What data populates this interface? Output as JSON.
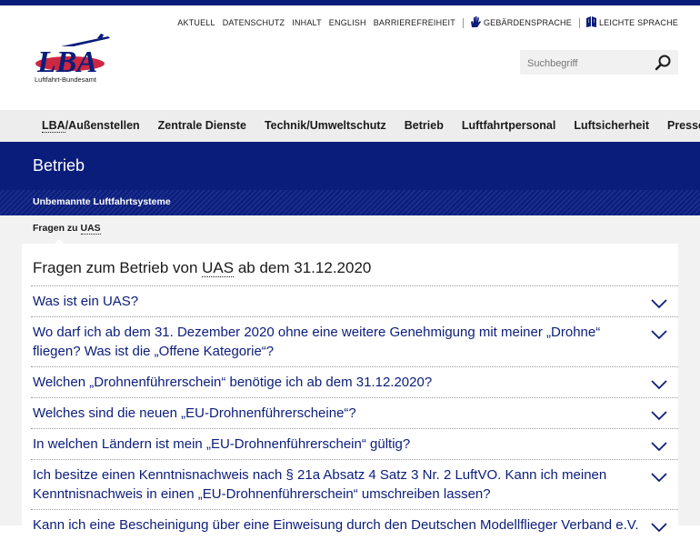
{
  "service_nav": {
    "aktuell": "AKTUELL",
    "datenschutz": "DATENSCHUTZ",
    "inhalt": "INHALT",
    "english": "ENGLISH",
    "barrierefreiheit": "BARRIEREFREIHEIT",
    "gebaerdensprache": "GEBÄRDENSPRACHE",
    "leichte_sprache": "LEICHTE SPRACHE"
  },
  "logo": {
    "letters": "LBA",
    "caption": "Luftfahrt-Bundesamt"
  },
  "search": {
    "placeholder": "Suchbegriff"
  },
  "main_nav": {
    "lba_abbr": "LBA",
    "lba_rest": "/Außenstellen",
    "zentrale": "Zentrale Dienste",
    "technik": "Technik/Umweltschutz",
    "betrieb": "Betrieb",
    "personal": "Luftfahrtpersonal",
    "sicherheit": "Luftsicherheit",
    "presse": "Presse"
  },
  "section_title": "Betrieb",
  "subsection_title": "Unbemannte Luftfahrtsysteme",
  "breadcrumb": {
    "prefix": "Fragen zu ",
    "abbr": "UAS"
  },
  "content": {
    "heading_pre": "Fragen zum Betrieb von ",
    "heading_abbr": "UAS",
    "heading_post": " ab dem 31.12.2020",
    "faq": [
      "Was ist ein UAS?",
      "Wo darf ich ab dem 31. Dezember 2020 ohne eine weitere Genehmigung mit meiner „Drohne“ fliegen? Was ist die „Offene Kategorie“?",
      "Welchen „Drohnenführerschein“ benötige ich ab dem 31.12.2020?",
      "Welches sind die neuen „EU-Drohnenführerscheine“?",
      "In welchen Ländern ist mein „EU-Drohnenführerschein“ gültig?",
      "Ich besitze einen Kenntnisnachweis nach § 21a Absatz 4 Satz 3 Nr. 2 LuftVO. Kann ich meinen Kenntnisnachweis in einen „EU-Drohnenführerschein“ umschreiben lassen?",
      "Kann ich eine Bescheinigung über eine Einweisung durch den Deutschen Modellflieger Verband e.V."
    ]
  },
  "colors": {
    "brand": "#0b1d7a",
    "nav_bg": "#ededed",
    "page_bg": "#f2f2f2"
  },
  "icons": {
    "search": "magnifier-icon",
    "chevron": "chevron-down-icon",
    "sign_language": "hand-icon",
    "easy_language": "book-icon"
  }
}
